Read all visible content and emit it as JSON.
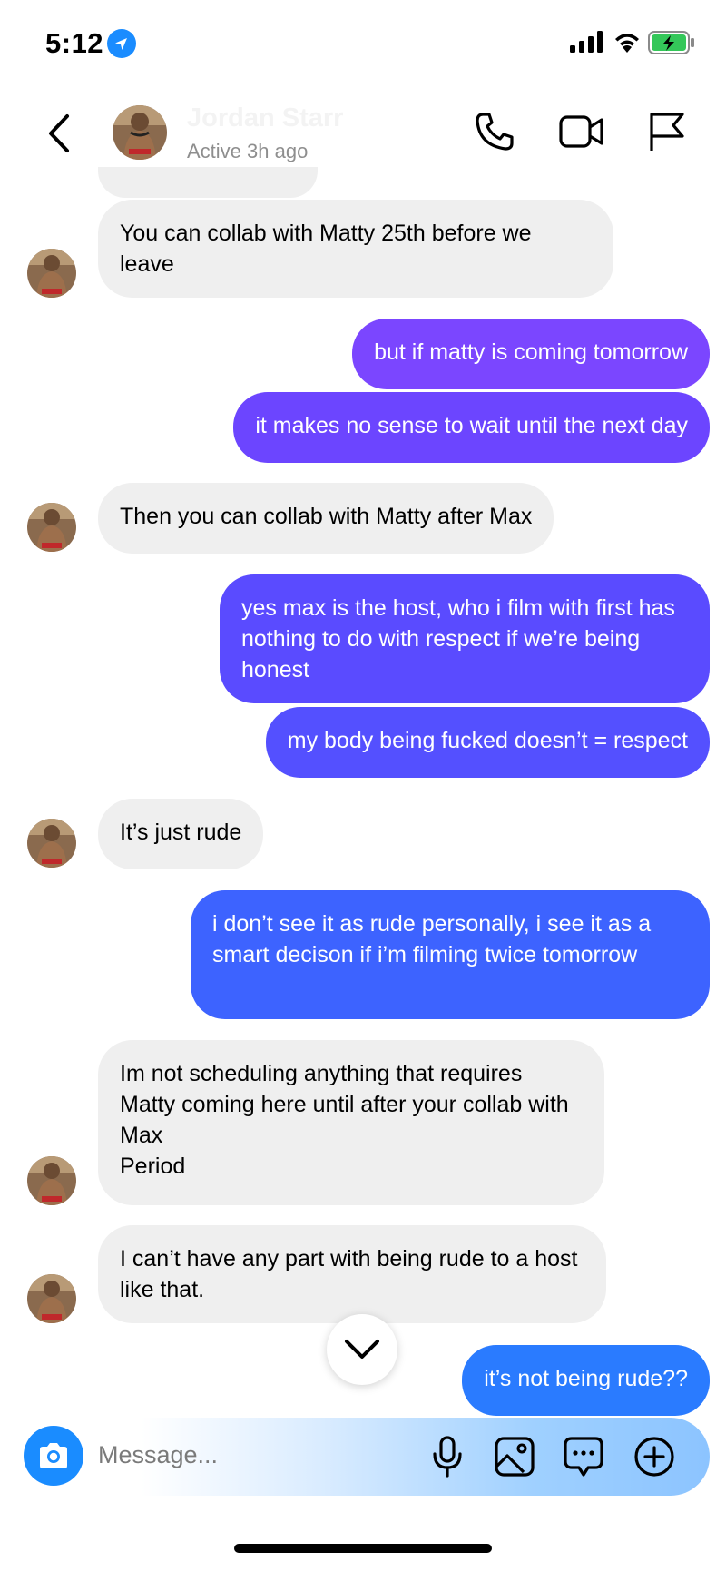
{
  "status_bar": {
    "time": "5:12"
  },
  "header": {
    "name": "Jordan Starr",
    "status": "Active 3h ago"
  },
  "messages": [
    {
      "dir": "in",
      "text": "You can collab with Matty 25th before we leave"
    },
    {
      "dir": "out",
      "text": "but if matty is coming tomorrow",
      "color": "#7b46ff"
    },
    {
      "dir": "out",
      "text": "it makes no sense to wait until the next day",
      "color": "#6c45ff"
    },
    {
      "dir": "in",
      "text": "Then you can collab with Matty after Max"
    },
    {
      "dir": "out",
      "text": "yes max is the host, who i film with first has nothing to do with respect if we’re being honest",
      "color": "#5a4bff"
    },
    {
      "dir": "out",
      "text": "my body being fucked doesn’t = respect",
      "color": "#5450ff"
    },
    {
      "dir": "in",
      "text": "It’s just rude"
    },
    {
      "dir": "out",
      "text": "i don’t see it as rude personally, i see it as a smart decison if i’m filming twice tomorrow",
      "color": "#3d63ff"
    },
    {
      "dir": "in",
      "text": "Im not scheduling anything that requires Matty coming here until after your collab with Max\nPeriod"
    },
    {
      "dir": "in",
      "text": "I can’t have any part with being rude to a host like that."
    },
    {
      "dir": "out",
      "text": "it’s not being rude??",
      "color": "#2a7bff"
    }
  ],
  "composer": {
    "placeholder": "Message..."
  },
  "colors": {
    "accent": "#1a8cff",
    "incoming_bubble": "#efefef"
  }
}
